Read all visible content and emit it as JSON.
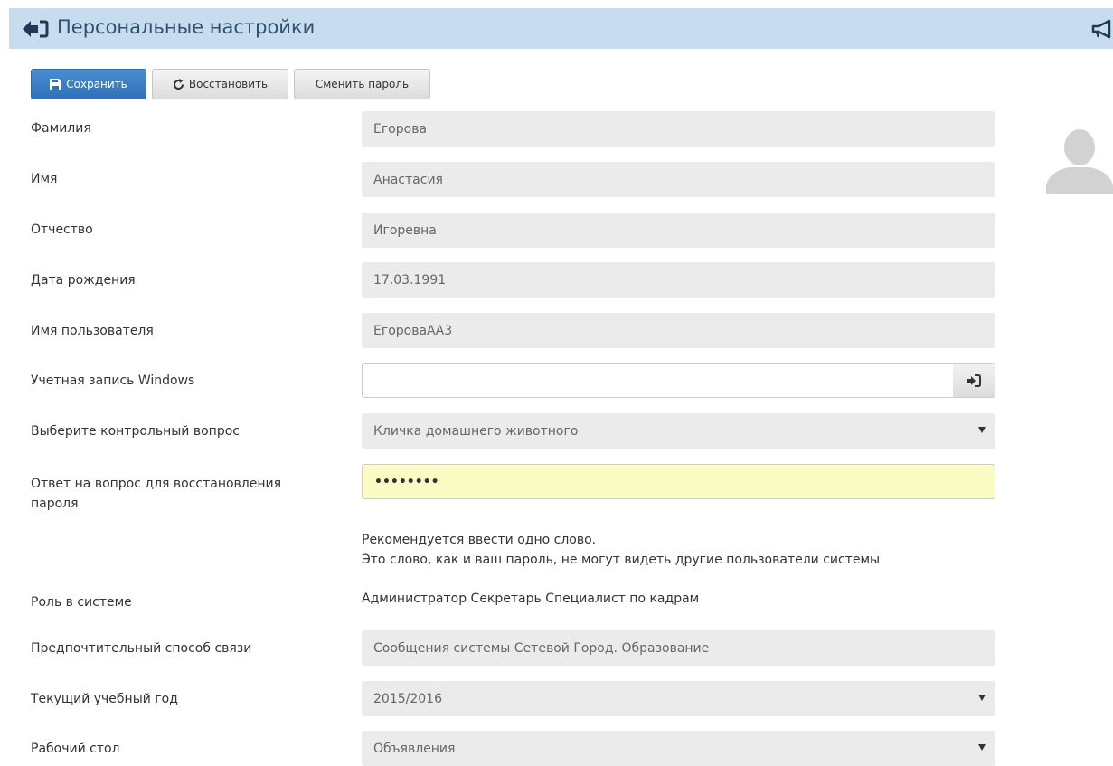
{
  "header": {
    "title": "Персональные настройки",
    "colors": {
      "bar": "#c8dcef",
      "title": "#2f4f6d"
    },
    "icons": [
      "back-arrow-icon",
      "megaphone-icon"
    ]
  },
  "toolbar": {
    "save_label": "Сохранить",
    "restore_label": "Восстановить",
    "change_password_label": "Сменить пароль",
    "save_color": "#337ab7"
  },
  "form": {
    "last_name": {
      "label": "Фамилия",
      "value": "Егорова"
    },
    "first_name": {
      "label": "Имя",
      "value": "Анастасия"
    },
    "patronymic": {
      "label": "Отчество",
      "value": "Игоревна"
    },
    "birth_date": {
      "label": "Дата рождения",
      "value": "17.03.1991"
    },
    "username": {
      "label": "Имя пользователя",
      "value": "ЕгороваАА3"
    },
    "windows_account": {
      "label": "Учетная запись Windows",
      "value": ""
    },
    "security_question": {
      "label": "Выберите контрольный вопрос",
      "value": "Кличка домашнего животного"
    },
    "security_answer": {
      "label_line1": "Ответ на вопрос для восстановления",
      "label_line2": "пароля",
      "value": "••••••••",
      "highlight_color": "#fbfbc4"
    },
    "hint": {
      "line1": "Рекомендуется ввести одно слово.",
      "line2": "Это слово, как и ваш пароль, не могут видеть другие пользователи системы"
    },
    "role": {
      "label": "Роль в системе",
      "value": "Администратор Секретарь Специалист по кадрам"
    },
    "contact_method": {
      "label": "Предпочтительный способ связи",
      "value": "Сообщения системы Сетевой Город. Образование"
    },
    "school_year": {
      "label": "Текущий учебный год",
      "value": "2015/2016"
    },
    "desktop": {
      "label": "Рабочий стол",
      "value": "Объявления"
    }
  }
}
